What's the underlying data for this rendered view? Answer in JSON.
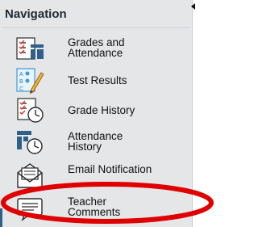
{
  "nav": {
    "title": "Navigation",
    "items": [
      {
        "label": "Grades and Attendance",
        "icon": "grades-attendance-icon"
      },
      {
        "label": "Test Results",
        "icon": "test-results-icon"
      },
      {
        "label": "Grade History",
        "icon": "grade-history-icon"
      },
      {
        "label": "Attendance History",
        "icon": "attendance-history-icon"
      },
      {
        "label": "Email Notification",
        "icon": "email-notification-icon"
      },
      {
        "label": "Teacher Comments",
        "icon": "teacher-comments-icon"
      }
    ]
  },
  "colors": {
    "panel_bg": "#e4e6e8",
    "highlight_oval": "#e00000",
    "icon_blue": "#2f5f8a",
    "icon_red": "#d64b3c"
  }
}
